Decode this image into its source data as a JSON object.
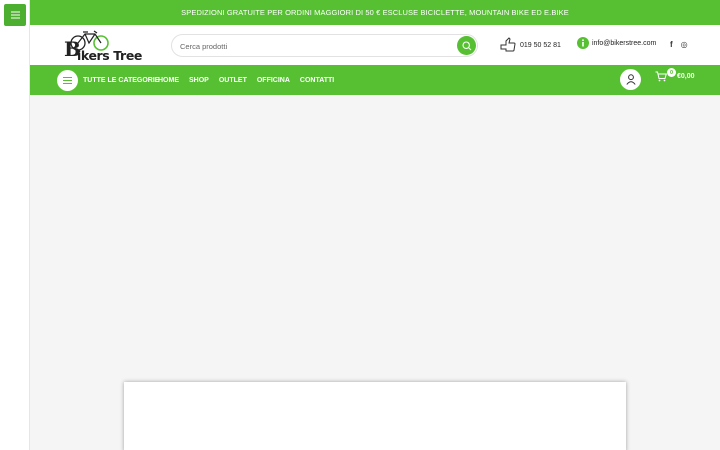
{
  "colors": {
    "brand_green": "#56c032",
    "dark_green": "#4caf2f",
    "text_dark": "#222222"
  },
  "sidebar": {
    "toggle_icon": "hamburger-icon"
  },
  "topbar": {
    "text": "SPEDIZIONI GRATUITE PER ORDINI MAGGIORI DI 50 € ESCLUSE BICICLETTE, MOUNTAIN BIKE ED E.BIKE"
  },
  "header": {
    "logo_text": "ikers Tree",
    "logo_initial": "B",
    "search": {
      "placeholder": "Cerca prodotti",
      "value": ""
    },
    "phone": "019 50 52 81",
    "email": "info@bikerstree.com",
    "social": {
      "facebook": "f",
      "instagram": "◎"
    }
  },
  "nav": {
    "categories_label": "TUTTE LE CATEGORIE",
    "items": [
      {
        "label": "HOME"
      },
      {
        "label": "SHOP"
      },
      {
        "label": "OUTLET"
      },
      {
        "label": "OFFICINA"
      },
      {
        "label": "CONTATTI"
      }
    ],
    "cart": {
      "count": "0",
      "total": "€0,00"
    }
  }
}
